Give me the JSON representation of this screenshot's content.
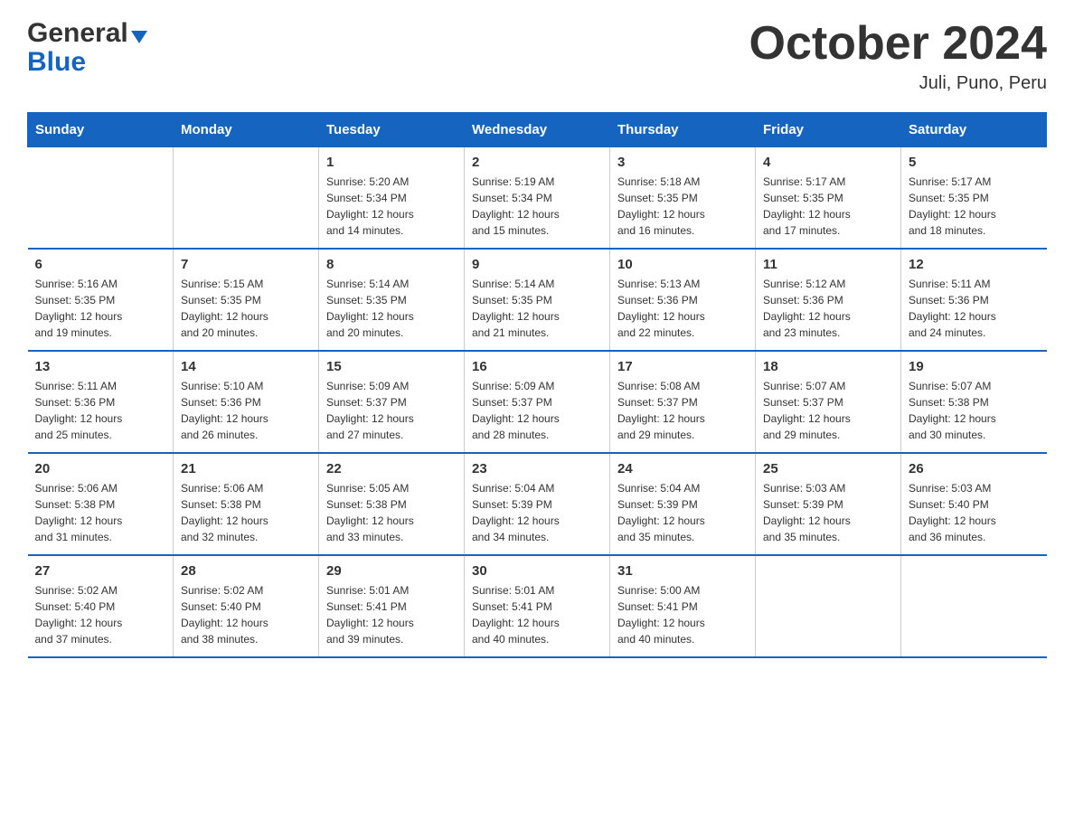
{
  "header": {
    "logo_line1": "General",
    "logo_line2": "Blue",
    "title": "October 2024",
    "subtitle": "Juli, Puno, Peru"
  },
  "days_of_week": [
    "Sunday",
    "Monday",
    "Tuesday",
    "Wednesday",
    "Thursday",
    "Friday",
    "Saturday"
  ],
  "weeks": [
    [
      {
        "day": "",
        "info": ""
      },
      {
        "day": "",
        "info": ""
      },
      {
        "day": "1",
        "info": "Sunrise: 5:20 AM\nSunset: 5:34 PM\nDaylight: 12 hours\nand 14 minutes."
      },
      {
        "day": "2",
        "info": "Sunrise: 5:19 AM\nSunset: 5:34 PM\nDaylight: 12 hours\nand 15 minutes."
      },
      {
        "day": "3",
        "info": "Sunrise: 5:18 AM\nSunset: 5:35 PM\nDaylight: 12 hours\nand 16 minutes."
      },
      {
        "day": "4",
        "info": "Sunrise: 5:17 AM\nSunset: 5:35 PM\nDaylight: 12 hours\nand 17 minutes."
      },
      {
        "day": "5",
        "info": "Sunrise: 5:17 AM\nSunset: 5:35 PM\nDaylight: 12 hours\nand 18 minutes."
      }
    ],
    [
      {
        "day": "6",
        "info": "Sunrise: 5:16 AM\nSunset: 5:35 PM\nDaylight: 12 hours\nand 19 minutes."
      },
      {
        "day": "7",
        "info": "Sunrise: 5:15 AM\nSunset: 5:35 PM\nDaylight: 12 hours\nand 20 minutes."
      },
      {
        "day": "8",
        "info": "Sunrise: 5:14 AM\nSunset: 5:35 PM\nDaylight: 12 hours\nand 20 minutes."
      },
      {
        "day": "9",
        "info": "Sunrise: 5:14 AM\nSunset: 5:35 PM\nDaylight: 12 hours\nand 21 minutes."
      },
      {
        "day": "10",
        "info": "Sunrise: 5:13 AM\nSunset: 5:36 PM\nDaylight: 12 hours\nand 22 minutes."
      },
      {
        "day": "11",
        "info": "Sunrise: 5:12 AM\nSunset: 5:36 PM\nDaylight: 12 hours\nand 23 minutes."
      },
      {
        "day": "12",
        "info": "Sunrise: 5:11 AM\nSunset: 5:36 PM\nDaylight: 12 hours\nand 24 minutes."
      }
    ],
    [
      {
        "day": "13",
        "info": "Sunrise: 5:11 AM\nSunset: 5:36 PM\nDaylight: 12 hours\nand 25 minutes."
      },
      {
        "day": "14",
        "info": "Sunrise: 5:10 AM\nSunset: 5:36 PM\nDaylight: 12 hours\nand 26 minutes."
      },
      {
        "day": "15",
        "info": "Sunrise: 5:09 AM\nSunset: 5:37 PM\nDaylight: 12 hours\nand 27 minutes."
      },
      {
        "day": "16",
        "info": "Sunrise: 5:09 AM\nSunset: 5:37 PM\nDaylight: 12 hours\nand 28 minutes."
      },
      {
        "day": "17",
        "info": "Sunrise: 5:08 AM\nSunset: 5:37 PM\nDaylight: 12 hours\nand 29 minutes."
      },
      {
        "day": "18",
        "info": "Sunrise: 5:07 AM\nSunset: 5:37 PM\nDaylight: 12 hours\nand 29 minutes."
      },
      {
        "day": "19",
        "info": "Sunrise: 5:07 AM\nSunset: 5:38 PM\nDaylight: 12 hours\nand 30 minutes."
      }
    ],
    [
      {
        "day": "20",
        "info": "Sunrise: 5:06 AM\nSunset: 5:38 PM\nDaylight: 12 hours\nand 31 minutes."
      },
      {
        "day": "21",
        "info": "Sunrise: 5:06 AM\nSunset: 5:38 PM\nDaylight: 12 hours\nand 32 minutes."
      },
      {
        "day": "22",
        "info": "Sunrise: 5:05 AM\nSunset: 5:38 PM\nDaylight: 12 hours\nand 33 minutes."
      },
      {
        "day": "23",
        "info": "Sunrise: 5:04 AM\nSunset: 5:39 PM\nDaylight: 12 hours\nand 34 minutes."
      },
      {
        "day": "24",
        "info": "Sunrise: 5:04 AM\nSunset: 5:39 PM\nDaylight: 12 hours\nand 35 minutes."
      },
      {
        "day": "25",
        "info": "Sunrise: 5:03 AM\nSunset: 5:39 PM\nDaylight: 12 hours\nand 35 minutes."
      },
      {
        "day": "26",
        "info": "Sunrise: 5:03 AM\nSunset: 5:40 PM\nDaylight: 12 hours\nand 36 minutes."
      }
    ],
    [
      {
        "day": "27",
        "info": "Sunrise: 5:02 AM\nSunset: 5:40 PM\nDaylight: 12 hours\nand 37 minutes."
      },
      {
        "day": "28",
        "info": "Sunrise: 5:02 AM\nSunset: 5:40 PM\nDaylight: 12 hours\nand 38 minutes."
      },
      {
        "day": "29",
        "info": "Sunrise: 5:01 AM\nSunset: 5:41 PM\nDaylight: 12 hours\nand 39 minutes."
      },
      {
        "day": "30",
        "info": "Sunrise: 5:01 AM\nSunset: 5:41 PM\nDaylight: 12 hours\nand 40 minutes."
      },
      {
        "day": "31",
        "info": "Sunrise: 5:00 AM\nSunset: 5:41 PM\nDaylight: 12 hours\nand 40 minutes."
      },
      {
        "day": "",
        "info": ""
      },
      {
        "day": "",
        "info": ""
      }
    ]
  ],
  "colors": {
    "header_bg": "#1565c0",
    "header_text": "#ffffff",
    "accent": "#1565c0"
  }
}
